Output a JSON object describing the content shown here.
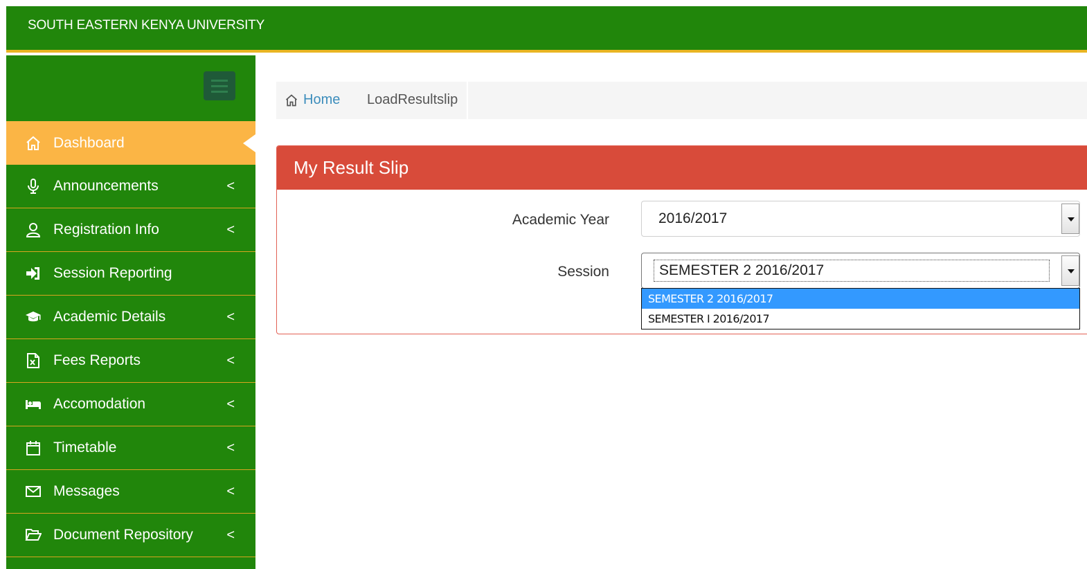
{
  "header": {
    "brand": "SOUTH EASTERN KENYA UNIVERSITY"
  },
  "sidebar": {
    "items": [
      {
        "label": "Dashboard",
        "icon": "home-icon",
        "active": true
      },
      {
        "label": "Announcements",
        "icon": "microphone-icon",
        "arrow": "<"
      },
      {
        "label": "Registration Info",
        "icon": "user-icon",
        "arrow": "<"
      },
      {
        "label": "Session Reporting",
        "icon": "sign-in-icon"
      },
      {
        "label": "Academic Details",
        "icon": "graduation-cap-icon",
        "arrow": "<"
      },
      {
        "label": "Fees Reports",
        "icon": "excel-file-icon",
        "arrow": "<"
      },
      {
        "label": "Accomodation",
        "icon": "bed-icon",
        "arrow": "<"
      },
      {
        "label": "Timetable",
        "icon": "calendar-icon",
        "arrow": "<"
      },
      {
        "label": "Messages",
        "icon": "envelope-icon",
        "arrow": "<"
      },
      {
        "label": "Document Repository",
        "icon": "folder-open-icon",
        "arrow": "<"
      }
    ]
  },
  "breadcrumb": {
    "home": "Home",
    "current": "LoadResultslip"
  },
  "panel": {
    "title": "My Result Slip",
    "academic_year": {
      "label": "Academic Year",
      "value": "2016/2017"
    },
    "session": {
      "label": "Session",
      "value": "SEMESTER 2 2016/2017",
      "options": [
        "SEMESTER 2 2016/2017",
        "SEMESTER I 2016/2017"
      ]
    }
  },
  "colors": {
    "header": "#21860b",
    "accent": "#e9b522",
    "active": "#fbb545",
    "panel": "#d84b3a",
    "link": "#3c8dbc"
  }
}
